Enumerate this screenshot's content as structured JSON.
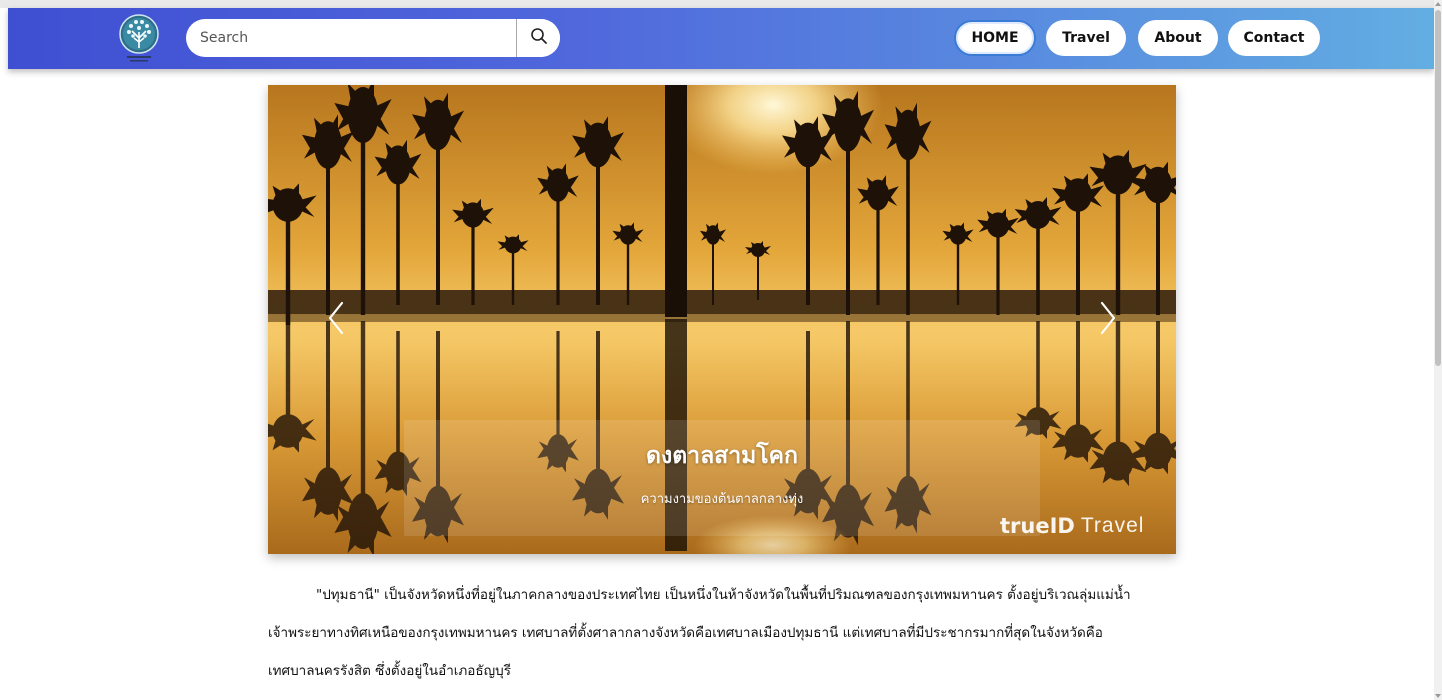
{
  "header": {
    "search": {
      "placeholder": "Search",
      "value": ""
    },
    "nav": [
      {
        "label": "HOME",
        "active": true
      },
      {
        "label": "Travel"
      },
      {
        "label": "About"
      },
      {
        "label": "Contact"
      }
    ],
    "icons": {
      "logo": "tree-logo-icon",
      "search": "search-icon"
    },
    "colors": {
      "navbar_start": "#3f4fd2",
      "navbar_end": "#62aee2",
      "active_border": "#3a7bd5"
    }
  },
  "carousel": {
    "slide_title": "ดงตาลสามโคก",
    "slide_subtitle": "ความงามของต้นตาลกลางทุ่ง",
    "watermark_brand": "trueID",
    "watermark_word": "Travel",
    "prev_icon": "chevron-left-icon",
    "next_icon": "chevron-right-icon"
  },
  "article": {
    "line1": "\"ปทุมธานี\" เป็นจังหวัดหนึ่งที่อยู่ในภาคกลางของประเทศไทย เป็นหนึ่งในห้าจังหวัดในพื้นที่ปริมณฑลของกรุงเทพมหานคร ตั้งอยู่บริเวณลุ่มแม่น้ำ",
    "line2": "เจ้าพระยาทางทิศเหนือของกรุงเทพมหานคร เทศบาลที่ตั้งศาลากลางจังหวัดคือเทศบาลเมืองปทุมธานี แต่เทศบาลที่มีประชากรมากที่สุดในจังหวัดคือ",
    "line3": "เทศบาลนครรังสิต ซึ่งตั้งอยู่ในอำเภอธัญบุรี"
  }
}
